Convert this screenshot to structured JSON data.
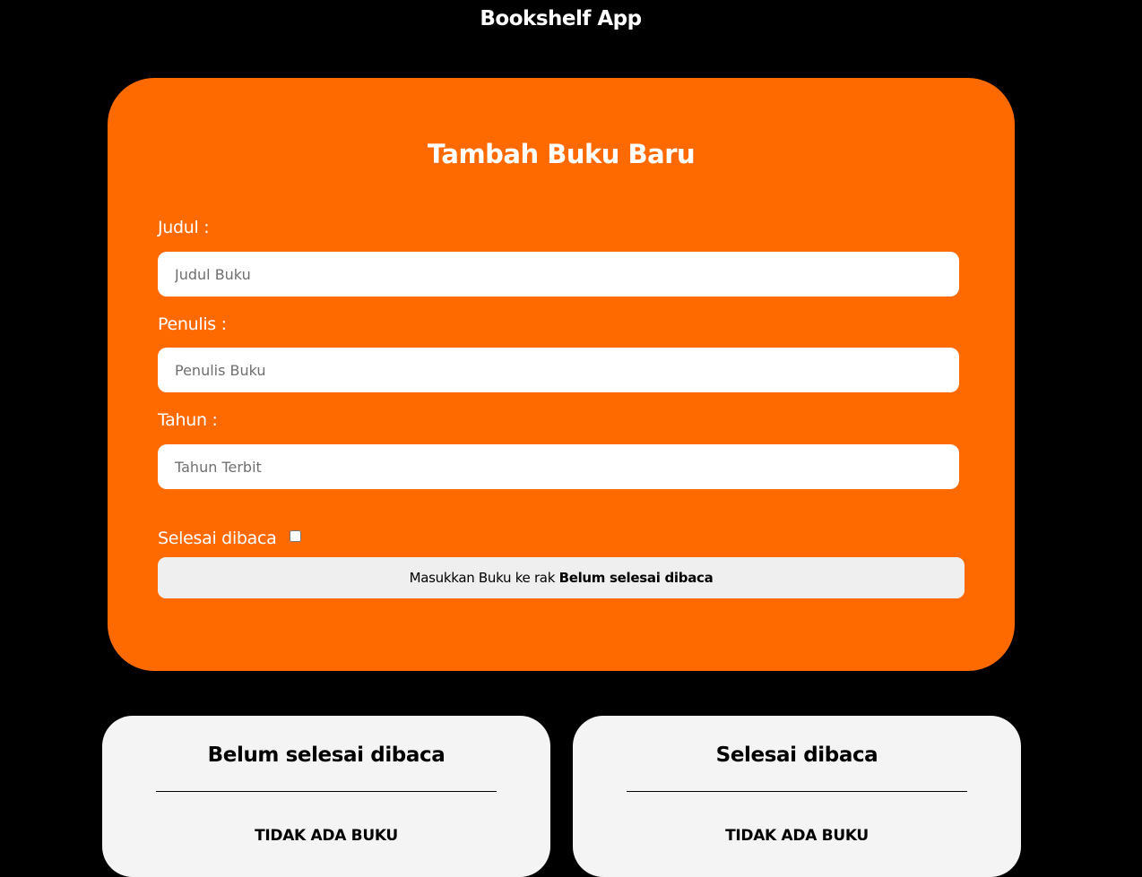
{
  "header": {
    "title": "Bookshelf App"
  },
  "form": {
    "title": "Tambah Buku Baru",
    "title_label": "Judul :",
    "title_placeholder": "Judul Buku",
    "author_label": "Penulis :",
    "author_placeholder": "Penulis Buku",
    "year_label": "Tahun :",
    "year_placeholder": "Tahun Terbit",
    "complete_label": "Selesai dibaca",
    "complete_checked": false,
    "submit_prefix": "Masukkan Buku ke rak",
    "submit_shelf": "Belum selesai dibaca"
  },
  "shelves": [
    {
      "title": "Belum selesai dibaca",
      "empty_text": "TIDAK ADA BUKU"
    },
    {
      "title": "Selesai dibaca",
      "empty_text": "TIDAK ADA BUKU"
    }
  ],
  "colors": {
    "background": "#000000",
    "form_card": "#ff6a00",
    "shelf_card": "#f4f4f4",
    "submit_button": "#efefef"
  }
}
